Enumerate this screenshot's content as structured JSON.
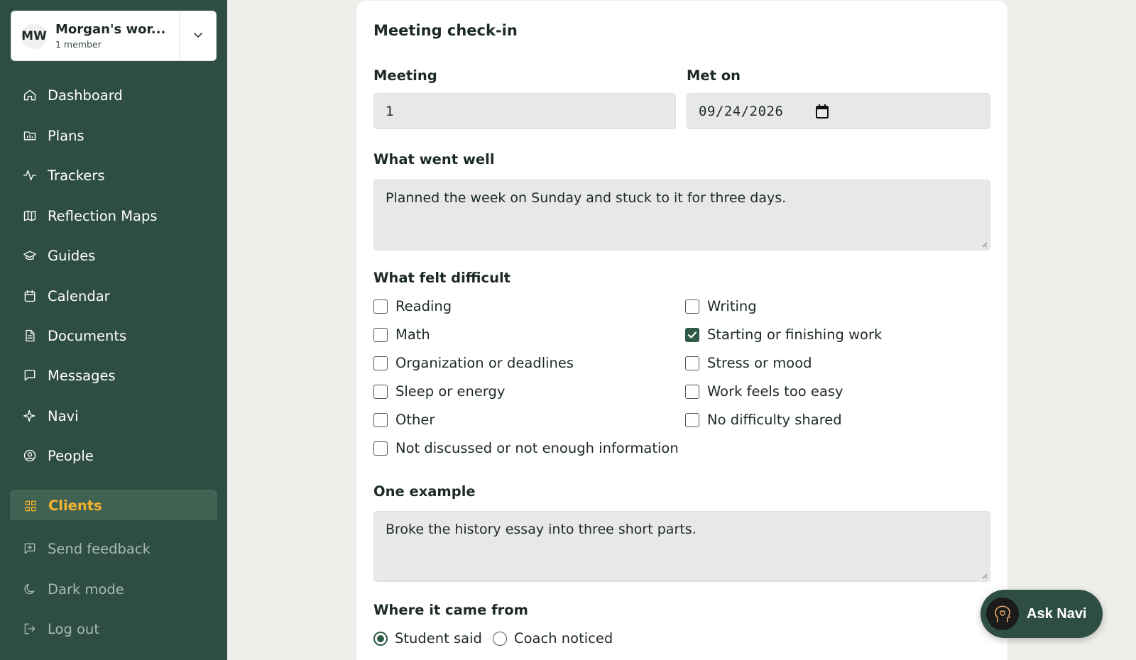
{
  "workspace": {
    "initials": "MW",
    "name": "Morgan's wor...",
    "members": "1 member"
  },
  "nav": {
    "items": [
      {
        "label": "Dashboard",
        "icon": "home-icon"
      },
      {
        "label": "Plans",
        "icon": "folder-chart-icon"
      },
      {
        "label": "Trackers",
        "icon": "activity-icon"
      },
      {
        "label": "Reflection Maps",
        "icon": "map-icon"
      },
      {
        "label": "Guides",
        "icon": "graduation-cap-icon"
      },
      {
        "label": "Calendar",
        "icon": "calendar-icon"
      },
      {
        "label": "Documents",
        "icon": "document-icon"
      },
      {
        "label": "Messages",
        "icon": "message-square-icon"
      },
      {
        "label": "Navi",
        "icon": "sparkle-icon"
      },
      {
        "label": "People",
        "icon": "user-circle-icon"
      },
      {
        "label": "Clients",
        "icon": "grid-icon",
        "active": true
      }
    ],
    "footer": [
      {
        "label": "Send feedback",
        "icon": "feedback-icon"
      },
      {
        "label": "Dark mode",
        "icon": "moon-icon"
      },
      {
        "label": "Log out",
        "icon": "logout-icon"
      }
    ],
    "active_color": "#f5b32d"
  },
  "form": {
    "title": "Meeting check-in",
    "meeting_label": "Meeting",
    "meeting_value": "1",
    "met_on_label": "Met on",
    "met_on_value": "09/24/2026",
    "went_well_label": "What went well",
    "went_well_value": "Planned the week on Sunday and stuck to it for three days.",
    "difficult_label": "What felt difficult",
    "difficulties": [
      {
        "label": "Reading",
        "checked": false
      },
      {
        "label": "Writing",
        "checked": false
      },
      {
        "label": "Math",
        "checked": false
      },
      {
        "label": "Starting or finishing work",
        "checked": true
      },
      {
        "label": "Organization or deadlines",
        "checked": false
      },
      {
        "label": "Stress or mood",
        "checked": false
      },
      {
        "label": "Sleep or energy",
        "checked": false
      },
      {
        "label": "Work feels too easy",
        "checked": false
      },
      {
        "label": "Other",
        "checked": false
      },
      {
        "label": "No difficulty shared",
        "checked": false
      },
      {
        "label": "Not discussed or not enough information",
        "checked": false
      }
    ],
    "example_label": "One example",
    "example_value": "Broke the history essay into three short parts.",
    "source_label": "Where it came from",
    "sources": [
      {
        "label": "Student said",
        "selected": true
      },
      {
        "label": "Coach noticed",
        "selected": false
      }
    ]
  },
  "ask_navi": {
    "label": "Ask Navi"
  },
  "colors": {
    "sidebar": "#2e4e43",
    "accent": "#f5b32d",
    "check": "#2e5a46"
  }
}
